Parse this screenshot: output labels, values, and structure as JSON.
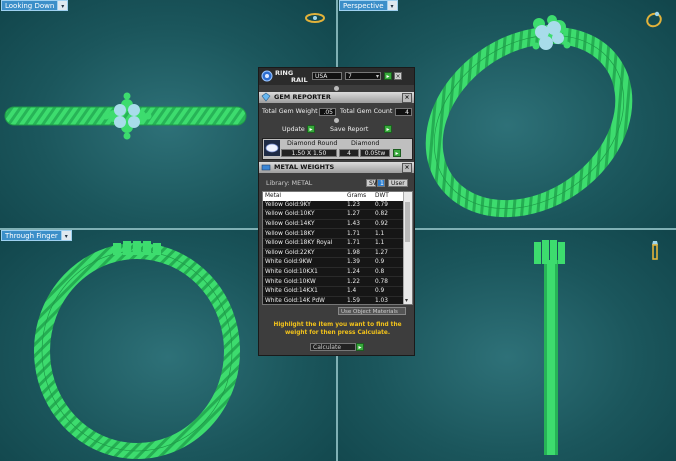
{
  "viewports": {
    "top_left": {
      "label": "Looking Down"
    },
    "top_right": {
      "label": "Perspective"
    },
    "bottom_left": {
      "label": "Through Finger"
    }
  },
  "ring_rail": {
    "title_line1": "RING",
    "title_line2": "RAIL",
    "size_system": "USA",
    "ring_size": "7"
  },
  "gem_reporter": {
    "title": "GEM REPORTER",
    "total_weight_label": "Total Gem Weight",
    "total_weight_value": ".05",
    "total_count_label": "Total Gem Count",
    "total_count_value": "4",
    "update_label": "Update",
    "save_report_label": "Save Report",
    "gem": {
      "name": "Diamond Round",
      "size": "1.50 X 1.50",
      "material": "Diamond",
      "count": "4",
      "weight": "0.05tw"
    }
  },
  "metal_weights": {
    "title": "METAL WEIGHTS",
    "library_label": "Library: METAL",
    "sv_label": "SV",
    "sv_value": "1",
    "user_label": "User",
    "columns": [
      "Metal",
      "Grams",
      "DWT"
    ],
    "rows": [
      {
        "metal": "Yellow Gold:9KY",
        "grams": "1.23",
        "dwt": "0.79"
      },
      {
        "metal": "Yellow Gold:10KY",
        "grams": "1.27",
        "dwt": "0.82"
      },
      {
        "metal": "Yellow Gold:14KY",
        "grams": "1.43",
        "dwt": "0.92"
      },
      {
        "metal": "Yellow Gold:18KY",
        "grams": "1.71",
        "dwt": "1.1"
      },
      {
        "metal": "Yellow Gold:18KY Royal",
        "grams": "1.71",
        "dwt": "1.1"
      },
      {
        "metal": "Yellow Gold:22KY",
        "grams": "1.98",
        "dwt": "1.27"
      },
      {
        "metal": "White Gold:9KW",
        "grams": "1.39",
        "dwt": "0.9"
      },
      {
        "metal": "White Gold:10KX1",
        "grams": "1.24",
        "dwt": "0.8"
      },
      {
        "metal": "White Gold:10KW",
        "grams": "1.22",
        "dwt": "0.78"
      },
      {
        "metal": "White Gold:14KX1",
        "grams": "1.4",
        "dwt": "0.9"
      },
      {
        "metal": "White Gold:14K PdW",
        "grams": "1.59",
        "dwt": "1.03"
      }
    ],
    "use_object_materials_label": "Use Object Materials",
    "instruction": "Highlight the item you want to find the weight for then press Calculate.",
    "calculate_label": "Calculate"
  },
  "colors": {
    "ring_green": "#3ddc6e",
    "gem_blue": "#a8dcea",
    "viewport_teal": "#1b565c",
    "instruction_yellow": "#f2c21b",
    "button_green": "#37a93b"
  }
}
